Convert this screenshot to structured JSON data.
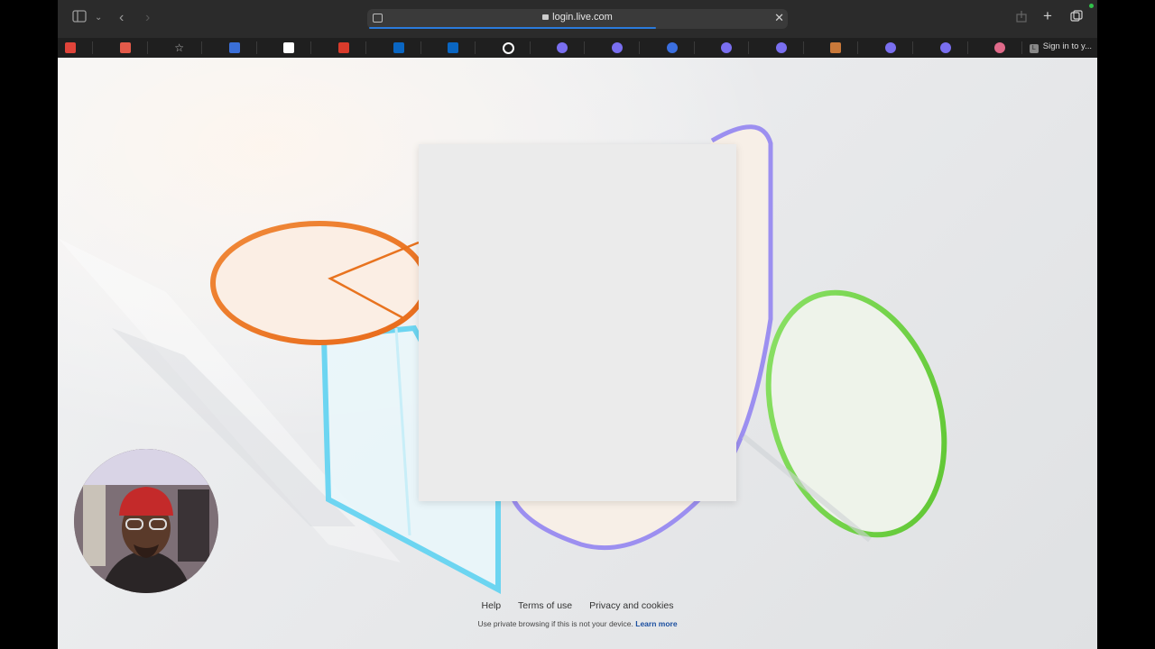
{
  "browser": {
    "url": "login.live.com",
    "tab_label": "Sign in to y...",
    "tab_favicon_letter": "L"
  },
  "bookmarks": [
    {
      "icon": "red-square-icon",
      "color": "#e0443a"
    },
    {
      "icon": "pdf-icon",
      "color": "#e35a4a"
    },
    {
      "icon": "star-icon",
      "color": "#bdbdbd"
    },
    {
      "icon": "shield-icon",
      "color": "#3a6fd8"
    },
    {
      "icon": "tiktok-icon",
      "color": "#ffffff"
    },
    {
      "icon": "office-icon",
      "color": "#d93b2b"
    },
    {
      "icon": "linkedin-icon",
      "color": "#0a66c2"
    },
    {
      "icon": "linkedin-icon",
      "color": "#0a66c2"
    },
    {
      "icon": "github-icon",
      "color": "#ffffff"
    },
    {
      "icon": "gear-flower-icon",
      "color": "#7a6ff0"
    },
    {
      "icon": "gear-flower-icon",
      "color": "#7a6ff0"
    },
    {
      "icon": "blue-circle-icon",
      "color": "#3b6fe0"
    },
    {
      "icon": "gear-flower-icon",
      "color": "#7a6ff0"
    },
    {
      "icon": "gear-flower-icon",
      "color": "#7a6ff0"
    },
    {
      "icon": "image-icon",
      "color": "#c9793a"
    },
    {
      "icon": "gear-flower-icon",
      "color": "#7a6ff0"
    },
    {
      "icon": "gear-flower-icon",
      "color": "#7a6ff0"
    },
    {
      "icon": "brain-icon",
      "color": "#e06a8a"
    }
  ],
  "footer": {
    "help": "Help",
    "terms": "Terms of use",
    "privacy": "Privacy and cookies",
    "note": "Use private browsing if this is not your device.",
    "learn_more": "Learn more"
  }
}
